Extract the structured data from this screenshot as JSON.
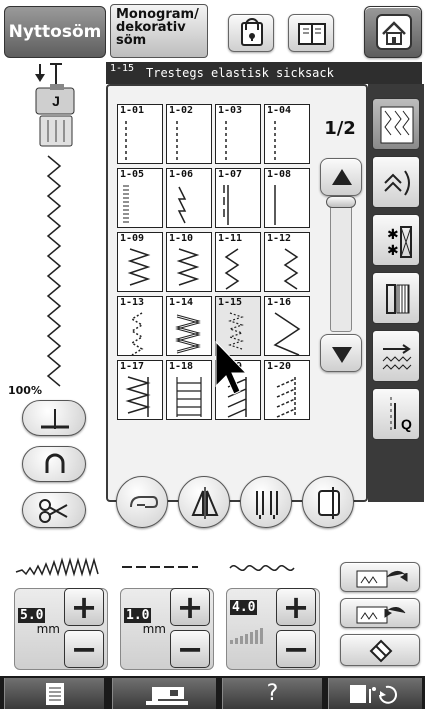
{
  "top": {
    "tab_utility": "Nyttosöm",
    "tab_monogram": "Monogram/ dekorativ söm"
  },
  "title_bar": {
    "number": "1-15",
    "name": "Trestegs elastisk sicksack"
  },
  "left": {
    "zoom": "100%"
  },
  "pager": {
    "page": "1/2"
  },
  "stitches": [
    {
      "code": "1-01",
      "pattern": "straight-left"
    },
    {
      "code": "1-02",
      "pattern": "straight-mid"
    },
    {
      "code": "1-03",
      "pattern": "straight-mid"
    },
    {
      "code": "1-04",
      "pattern": "straight-mid"
    },
    {
      "code": "1-05",
      "pattern": "triple-straight-left"
    },
    {
      "code": "1-06",
      "pattern": "stem"
    },
    {
      "code": "1-07",
      "pattern": "basting"
    },
    {
      "code": "1-08",
      "pattern": "straight-mid-solid"
    },
    {
      "code": "1-09",
      "pattern": "zigzag"
    },
    {
      "code": "1-10",
      "pattern": "zigzag"
    },
    {
      "code": "1-11",
      "pattern": "zigzag-left"
    },
    {
      "code": "1-12",
      "pattern": "zigzag-right"
    },
    {
      "code": "1-13",
      "pattern": "elastic-zigzag"
    },
    {
      "code": "1-14",
      "pattern": "triple-zigzag"
    },
    {
      "code": "1-15",
      "pattern": "three-step-zigzag"
    },
    {
      "code": "1-16",
      "pattern": "zigzag-wide"
    },
    {
      "code": "1-17",
      "pattern": "overcast"
    },
    {
      "code": "1-18",
      "pattern": "ladder"
    },
    {
      "code": "1-19",
      "pattern": "slant"
    },
    {
      "code": "1-20",
      "pattern": "slant-dashed"
    }
  ],
  "settings": {
    "width": {
      "value": "5.0",
      "unit": "mm"
    },
    "length": {
      "value": "1.0",
      "unit": "mm"
    },
    "tension": {
      "value": "4.0"
    }
  },
  "bottom_bar": {
    "help_label": "?"
  },
  "selected_code": "1-15"
}
